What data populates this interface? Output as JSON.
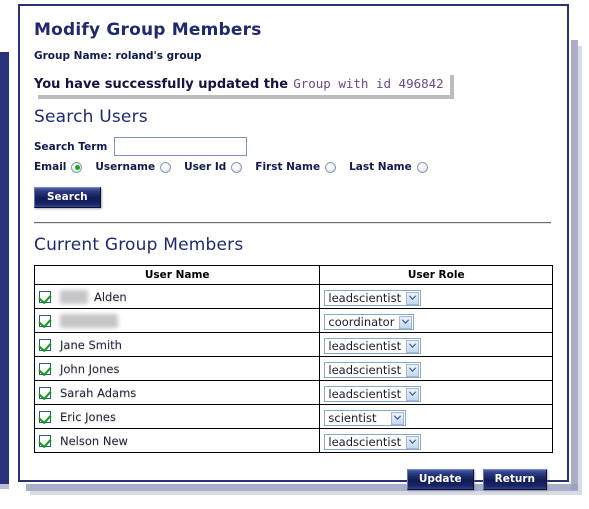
{
  "page": {
    "title": "Modify Group Members",
    "group_name_label": "Group Name: roland's group",
    "flash_bold": "You have successfully updated the",
    "flash_id": "Group with id 496842",
    "search_heading": "Search Users",
    "members_heading": "Current Group Members"
  },
  "search": {
    "term_label": "Search Term",
    "term_value": "",
    "term_placeholder": "",
    "options": [
      {
        "label": "Email",
        "selected": true
      },
      {
        "label": "Username",
        "selected": false
      },
      {
        "label": "User Id",
        "selected": false
      },
      {
        "label": "First Name",
        "selected": false
      },
      {
        "label": "Last Name",
        "selected": false
      }
    ],
    "search_button": "Search"
  },
  "table": {
    "headers": [
      "User Name",
      "User Role"
    ],
    "rows": [
      {
        "checked": true,
        "prefix": "Paul",
        "prefix_redacted": true,
        "name": "Alden",
        "name_redacted": false,
        "role": "leadscientist"
      },
      {
        "checked": true,
        "prefix": "",
        "prefix_redacted": false,
        "name": "Paul User",
        "name_redacted": true,
        "role": "coordinator"
      },
      {
        "checked": true,
        "prefix": "",
        "prefix_redacted": false,
        "name": "Jane Smith",
        "name_redacted": false,
        "role": "leadscientist"
      },
      {
        "checked": true,
        "prefix": "",
        "prefix_redacted": false,
        "name": "John Jones",
        "name_redacted": false,
        "role": "leadscientist"
      },
      {
        "checked": true,
        "prefix": "",
        "prefix_redacted": false,
        "name": "Sarah Adams",
        "name_redacted": false,
        "role": "leadscientist"
      },
      {
        "checked": true,
        "prefix": "",
        "prefix_redacted": false,
        "name": "Eric Jones",
        "name_redacted": false,
        "role": "scientist"
      },
      {
        "checked": true,
        "prefix": "",
        "prefix_redacted": false,
        "name": "Nelson New",
        "name_redacted": false,
        "role": "leadscientist"
      }
    ]
  },
  "footer": {
    "update_button": "Update",
    "return_button": "Return"
  },
  "colors": {
    "heading": "#1f2a6e",
    "frame_border": "#26337a",
    "flash_id": "#6b4b86",
    "radio_selected": "#18a818",
    "checkbox_check": "#149a14",
    "select_border": "#8aa7cc"
  },
  "icons": {
    "dropdown": "chevron-down-icon",
    "checkbox": "checkbox-checked-icon",
    "radio": "radio-button-icon"
  }
}
